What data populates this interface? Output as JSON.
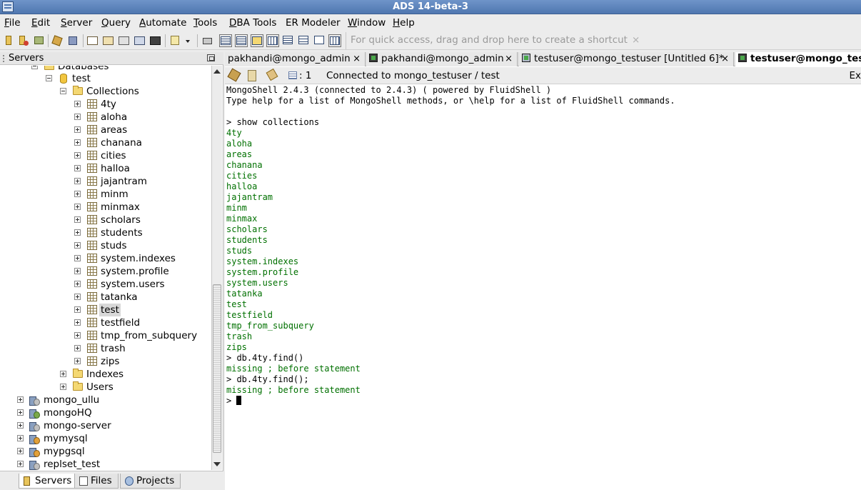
{
  "window": {
    "title": "ADS 14-beta-3"
  },
  "menu": [
    "File",
    "Edit",
    "Server",
    "Query",
    "Automate",
    "Tools",
    "DBA Tools",
    "ER Modeler",
    "Window",
    "Help"
  ],
  "menu_mnemonics": [
    "F",
    "E",
    "S",
    "Q",
    "A",
    "T",
    "D",
    "",
    "W",
    "H"
  ],
  "toolbar": {
    "quick_access_placeholder": "For quick access, drag and drop here to create a shortcut",
    "quick_access_close": "×"
  },
  "servers_panel": {
    "title": "Servers",
    "tree": {
      "databases_label": "Databases",
      "db_name": "test",
      "collections_label": "Collections",
      "collections": [
        "4ty",
        "aloha",
        "areas",
        "chanana",
        "cities",
        "halloa",
        "jajantram",
        "minm",
        "minmax",
        "scholars",
        "students",
        "studs",
        "system.indexes",
        "system.profile",
        "system.users",
        "tatanka",
        "test",
        "testfield",
        "tmp_from_subquery",
        "trash",
        "zips"
      ],
      "selected_collection": "test",
      "indexes_label": "Indexes",
      "users_label": "Users",
      "servers": [
        "mongo_ullu",
        "mongoHQ",
        "mongo-server",
        "mymysql",
        "mypgsql",
        "replset_test"
      ]
    },
    "bottom_tabs": [
      "Servers",
      "Files",
      "Projects"
    ]
  },
  "editor": {
    "tabs": [
      {
        "label": "pakhandi@mongo_admin",
        "close": "×"
      },
      {
        "label": "pakhandi@mongo_admin",
        "close": "×"
      },
      {
        "label": "testuser@mongo_testuser [Untitled 6]*",
        "close": "×"
      },
      {
        "label": "testuser@mongo_testuser",
        "close": ""
      }
    ],
    "row_indicator": ": 1",
    "status": "Connected to mongo_testuser / test",
    "right_cut_label": "Ex"
  },
  "console": {
    "lines": [
      {
        "kind": "plain",
        "text": "MongoShell 2.4.3 (connected to 2.4.3) ( powered by FluidShell )"
      },
      {
        "kind": "plain",
        "text": "Type help for a list of MongoShell methods, or \\help for a list of FluidShell commands."
      },
      {
        "kind": "blank",
        "text": ""
      },
      {
        "kind": "plain",
        "text": "> show collections"
      },
      {
        "kind": "out",
        "text": "4ty"
      },
      {
        "kind": "out",
        "text": "aloha"
      },
      {
        "kind": "out",
        "text": "areas"
      },
      {
        "kind": "out",
        "text": "chanana"
      },
      {
        "kind": "out",
        "text": "cities"
      },
      {
        "kind": "out",
        "text": "halloa"
      },
      {
        "kind": "out",
        "text": "jajantram"
      },
      {
        "kind": "out",
        "text": "minm"
      },
      {
        "kind": "out",
        "text": "minmax"
      },
      {
        "kind": "out",
        "text": "scholars"
      },
      {
        "kind": "out",
        "text": "students"
      },
      {
        "kind": "out",
        "text": "studs"
      },
      {
        "kind": "out",
        "text": "system.indexes"
      },
      {
        "kind": "out",
        "text": "system.profile"
      },
      {
        "kind": "out",
        "text": "system.users"
      },
      {
        "kind": "out",
        "text": "tatanka"
      },
      {
        "kind": "out",
        "text": "test"
      },
      {
        "kind": "out",
        "text": "testfield"
      },
      {
        "kind": "out",
        "text": "tmp_from_subquery"
      },
      {
        "kind": "out",
        "text": "trash"
      },
      {
        "kind": "out",
        "text": "zips"
      },
      {
        "kind": "plain",
        "text": "> db.4ty.find()"
      },
      {
        "kind": "out",
        "text": "missing ; before statement"
      },
      {
        "kind": "plain",
        "text": "> db.4ty.find();"
      },
      {
        "kind": "out",
        "text": "missing ; before statement"
      }
    ],
    "prompt": "> "
  },
  "colors": {
    "output_text": "#007000",
    "titlebar": "#5b80b8",
    "selection": "#d8d8d8"
  }
}
